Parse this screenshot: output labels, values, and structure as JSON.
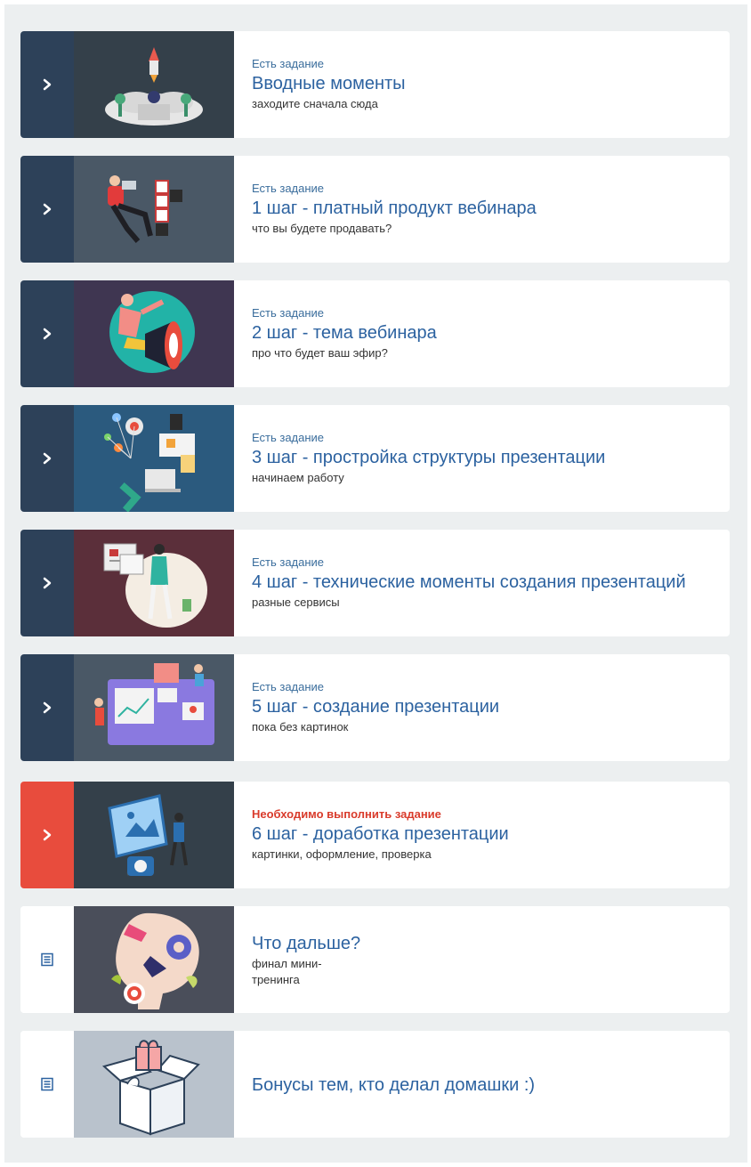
{
  "lessons": [
    {
      "status": "Есть задание",
      "title": "Вводные моменты",
      "subtitle": "заходите сначала сюда",
      "state": "locked-task"
    },
    {
      "status": "Есть задание",
      "title": "1 шаг - платный продукт вебинара",
      "subtitle": "что вы будете продавать?",
      "state": "locked-task"
    },
    {
      "status": "Есть задание",
      "title": "2 шаг - тема вебинара",
      "subtitle": "про что будет ваш эфир?",
      "state": "locked-task"
    },
    {
      "status": "Есть задание",
      "title": "3 шаг - простройка структуры презентации",
      "subtitle": "начинаем работу",
      "state": "locked-task"
    },
    {
      "status": "Есть задание",
      "title": "4 шаг - технические моменты создания презентаций",
      "subtitle": "разные сервисы",
      "state": "locked-task"
    },
    {
      "status": "Есть задание",
      "title": "5 шаг - создание презентации",
      "subtitle": "пока без картинок",
      "state": "locked-task"
    },
    {
      "status": "Необходимо выполнить задание",
      "title": "6 шаг - доработка презентации",
      "subtitle": "картинки, оформление, проверка",
      "state": "required-task"
    },
    {
      "title": "Что дальше?",
      "subtitle": "финал мини-тренинга",
      "state": "lesson"
    },
    {
      "title": "Бонусы тем, кто делал домашки :)",
      "state": "lesson"
    }
  ],
  "colors": {
    "panel_bg": "#eceff0",
    "side_dark": "#2d4159",
    "side_red": "#e84c3d",
    "title_blue": "#2c62a0",
    "status_blue": "#3a6d9c",
    "status_red": "#d93b2b"
  },
  "icons": {
    "task": "chevron-right-icon",
    "lesson": "list-document-icon"
  }
}
